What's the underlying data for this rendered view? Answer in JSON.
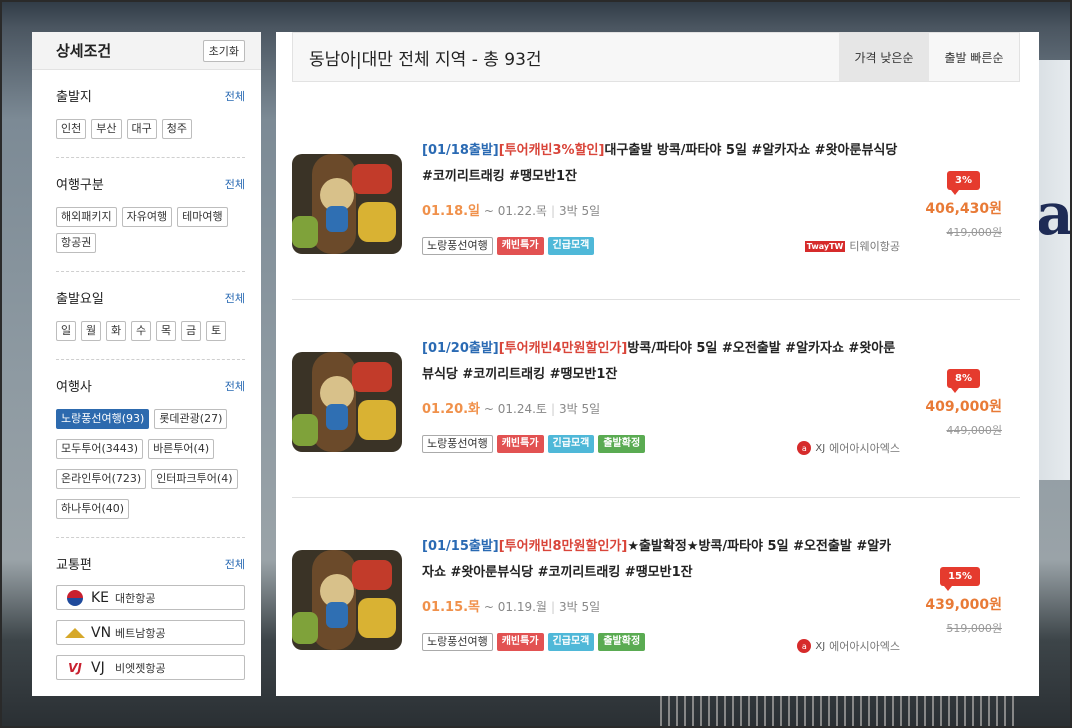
{
  "sidebar": {
    "title": "상세조건",
    "reset_label": "초기화",
    "all_label": "전체",
    "sections": [
      {
        "title": "출발지",
        "tags": [
          "인천",
          "부산",
          "대구",
          "청주"
        ]
      },
      {
        "title": "여행구분",
        "tags": [
          "해외패키지",
          "자유여행",
          "테마여행",
          "항공권"
        ]
      },
      {
        "title": "출발요일",
        "tags": [
          "일",
          "월",
          "화",
          "수",
          "목",
          "금",
          "토"
        ]
      },
      {
        "title": "여행사",
        "tags": [
          "노랑풍선여행(93)",
          "롯데관광(27)",
          "모두투어(3443)",
          "바른투어(4)",
          "온라인투어(723)",
          "인터파크투어(4)",
          "하나투어(40)"
        ],
        "selected": "노랑풍선여행(93)"
      },
      {
        "title": "교통편",
        "airlines": [
          {
            "code": "KE",
            "name": "대한항공",
            "icon": "korean-air-logo-icon"
          },
          {
            "code": "VN",
            "name": "베트남항공",
            "icon": "vietnam-airlines-logo-icon"
          },
          {
            "code": "VJ",
            "name": "비엣젯항공",
            "icon": "vietjet-logo-icon"
          }
        ]
      }
    ]
  },
  "main": {
    "title": "동남아|대만 전체 지역 - 총 93건",
    "sort_tabs": [
      "가격 낮은순",
      "출발 빠른순"
    ]
  },
  "items": [
    {
      "date_tag": "[01/18출발]",
      "cabin_tag": "[투어캐빈3%할인]",
      "title_rest": "대구출발 방콕/파타야 5일 #알카자쇼 #왓아룬뷰식당 #코끼리트래킹 #땡모반1잔",
      "start": "01.18.일",
      "end": "~ 01.22.목",
      "duration": "3박 5일",
      "agency": "노랑풍선여행",
      "badges": [
        "캐빈특가",
        "긴급모객"
      ],
      "airline_logo": "TwayTW",
      "airline_name": "티웨이항공",
      "discount": "3%",
      "price": "406,430원",
      "orig_price": "419,000원"
    },
    {
      "date_tag": "[01/20출발]",
      "cabin_tag": "[투어캐빈4만원할인가]",
      "title_rest": "방콕/파타야 5일 #오전출발 #알카자쇼 #왓아룬뷰식당 #코끼리트래킹 #땡모반1잔",
      "start": "01.20.화",
      "end": "~ 01.24.토",
      "duration": "3박 5일",
      "agency": "노랑풍선여행",
      "badges": [
        "캐빈특가",
        "긴급모객",
        "출발확정"
      ],
      "airline_logo": "XJ",
      "airline_name": "에어아시아엑스",
      "discount": "8%",
      "price": "409,000원",
      "orig_price": "449,000원"
    },
    {
      "date_tag": "[01/15출발]",
      "cabin_tag": "[투어캐빈8만원할인가]",
      "title_rest": "★출발확정★방콕/파타야 5일 #오전출발 #알카자쇼 #왓아룬뷰식당 #코끼리트래킹 #땡모반1잔",
      "start": "01.15.목",
      "end": "~ 01.19.월",
      "duration": "3박 5일",
      "agency": "노랑풍선여행",
      "badges": [
        "캐빈특가",
        "긴급모객",
        "출발확정"
      ],
      "airline_logo": "XJ",
      "airline_name": "에어아시아엑스",
      "discount": "15%",
      "price": "439,000원",
      "orig_price": "519,000원"
    }
  ],
  "colors": {
    "accent_blue": "#2d6aae",
    "price_orange": "#e87a36",
    "discount_red": "#e53b2e"
  }
}
